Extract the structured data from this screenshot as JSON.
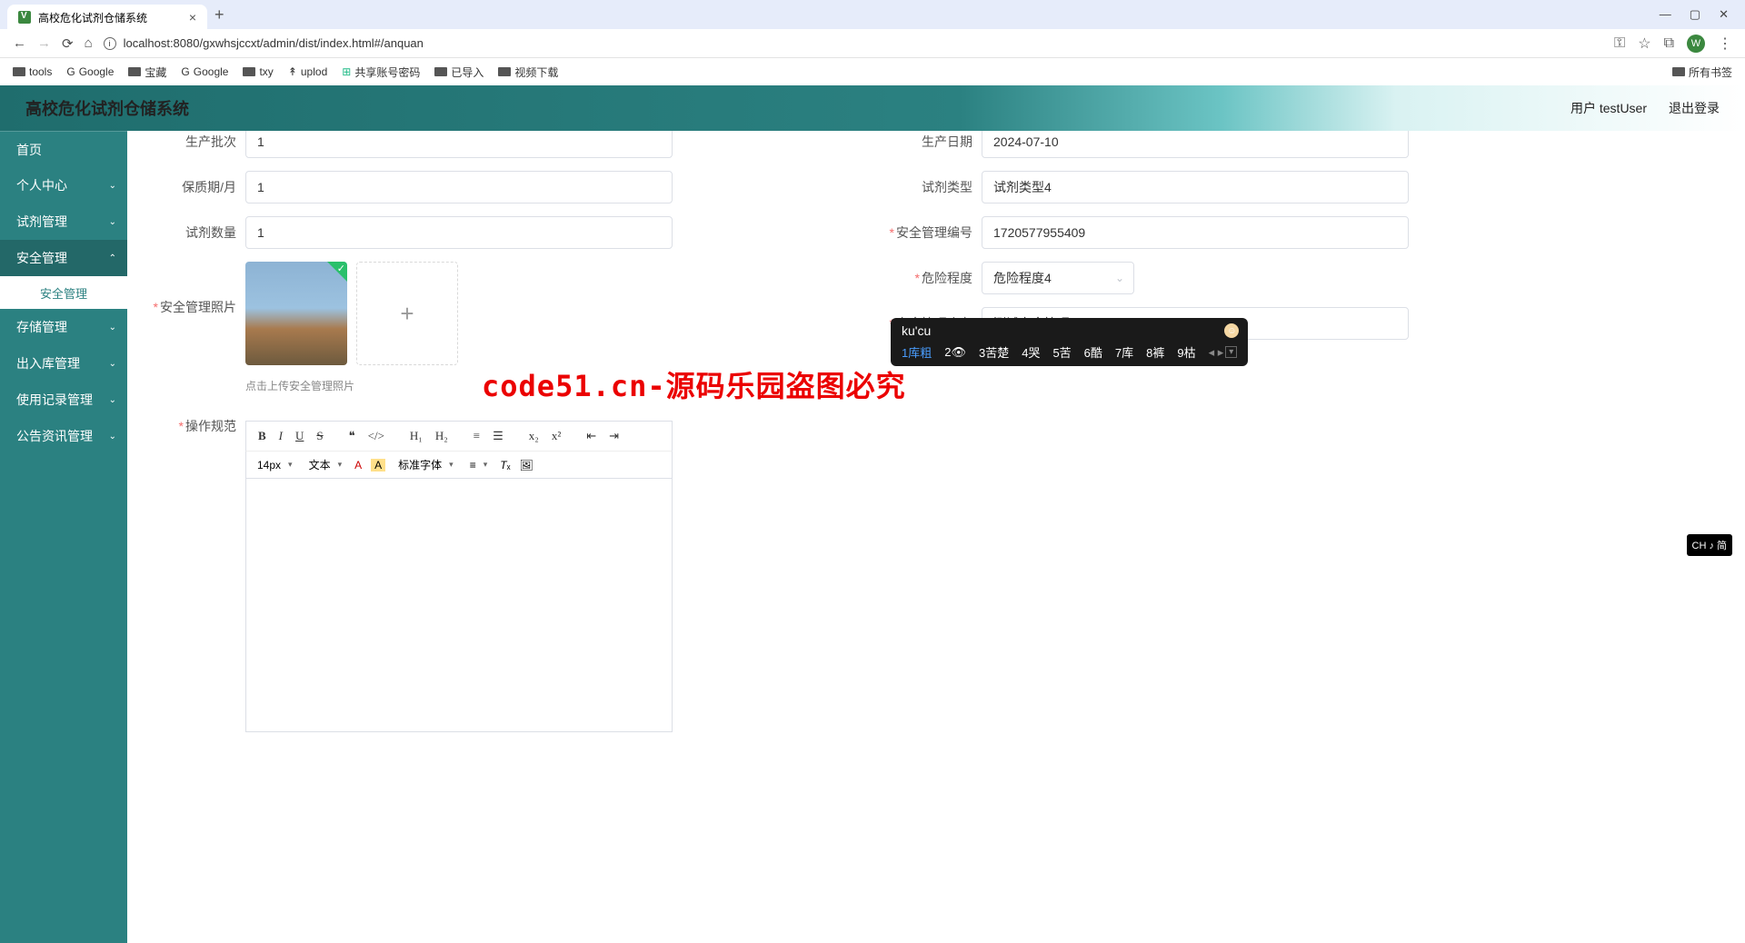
{
  "browser": {
    "tab_title": "高校危化试剂仓储系统",
    "url": "localhost:8080/gxwhsjccxt/admin/dist/index.html#/anquan",
    "bookmarks": [
      "tools",
      "Google",
      "宝藏",
      "Google",
      "txy",
      "uplod",
      "共享账号密码",
      "已导入",
      "视频下载"
    ],
    "all_bookmarks": "所有书签"
  },
  "header": {
    "title": "高校危化试剂仓储系统",
    "user_label": "用户 testUser",
    "logout": "退出登录"
  },
  "sidebar": {
    "items": [
      {
        "label": "首页"
      },
      {
        "label": "个人中心"
      },
      {
        "label": "试剂管理"
      },
      {
        "label": "安全管理",
        "active": true,
        "sub": [
          {
            "label": "安全管理"
          }
        ]
      },
      {
        "label": "存储管理"
      },
      {
        "label": "出入库管理"
      },
      {
        "label": "使用记录管理"
      },
      {
        "label": "公告资讯管理"
      }
    ]
  },
  "form": {
    "batch": {
      "label": "生产批次",
      "value": "1"
    },
    "prod_date": {
      "label": "生产日期",
      "value": "2024-07-10"
    },
    "shelf_life": {
      "label": "保质期/月",
      "value": "1"
    },
    "reagent_type": {
      "label": "试剂类型",
      "value": "试剂类型4"
    },
    "reagent_qty": {
      "label": "试剂数量",
      "value": "1"
    },
    "safety_id": {
      "label": "安全管理编号",
      "required": true,
      "value": "1720577955409"
    },
    "safety_photo": {
      "label": "安全管理照片",
      "required": true
    },
    "danger_level": {
      "label": "危险程度",
      "required": true,
      "value": "危险程度4"
    },
    "safety_stock": {
      "label": "安全管理库存",
      "required": true,
      "value": "测试安全管理kucu"
    },
    "upload_hint": "点击上传安全管理照片",
    "procedure": {
      "label": "操作规范",
      "required": true
    }
  },
  "editor": {
    "font_size": "14px",
    "font_menu": "文本",
    "font_family": "标准字体"
  },
  "ime": {
    "typing": "ku'cu",
    "candidates": [
      "1库粗",
      "2👁",
      "3苦楚",
      "4哭",
      "5苦",
      "6酷",
      "7库",
      "8裤",
      "9枯"
    ]
  },
  "watermark_text": "code51.cn",
  "red_banner": "code51.cn-源码乐园盗图必究",
  "lang_indicator": "CH ♪ 简"
}
